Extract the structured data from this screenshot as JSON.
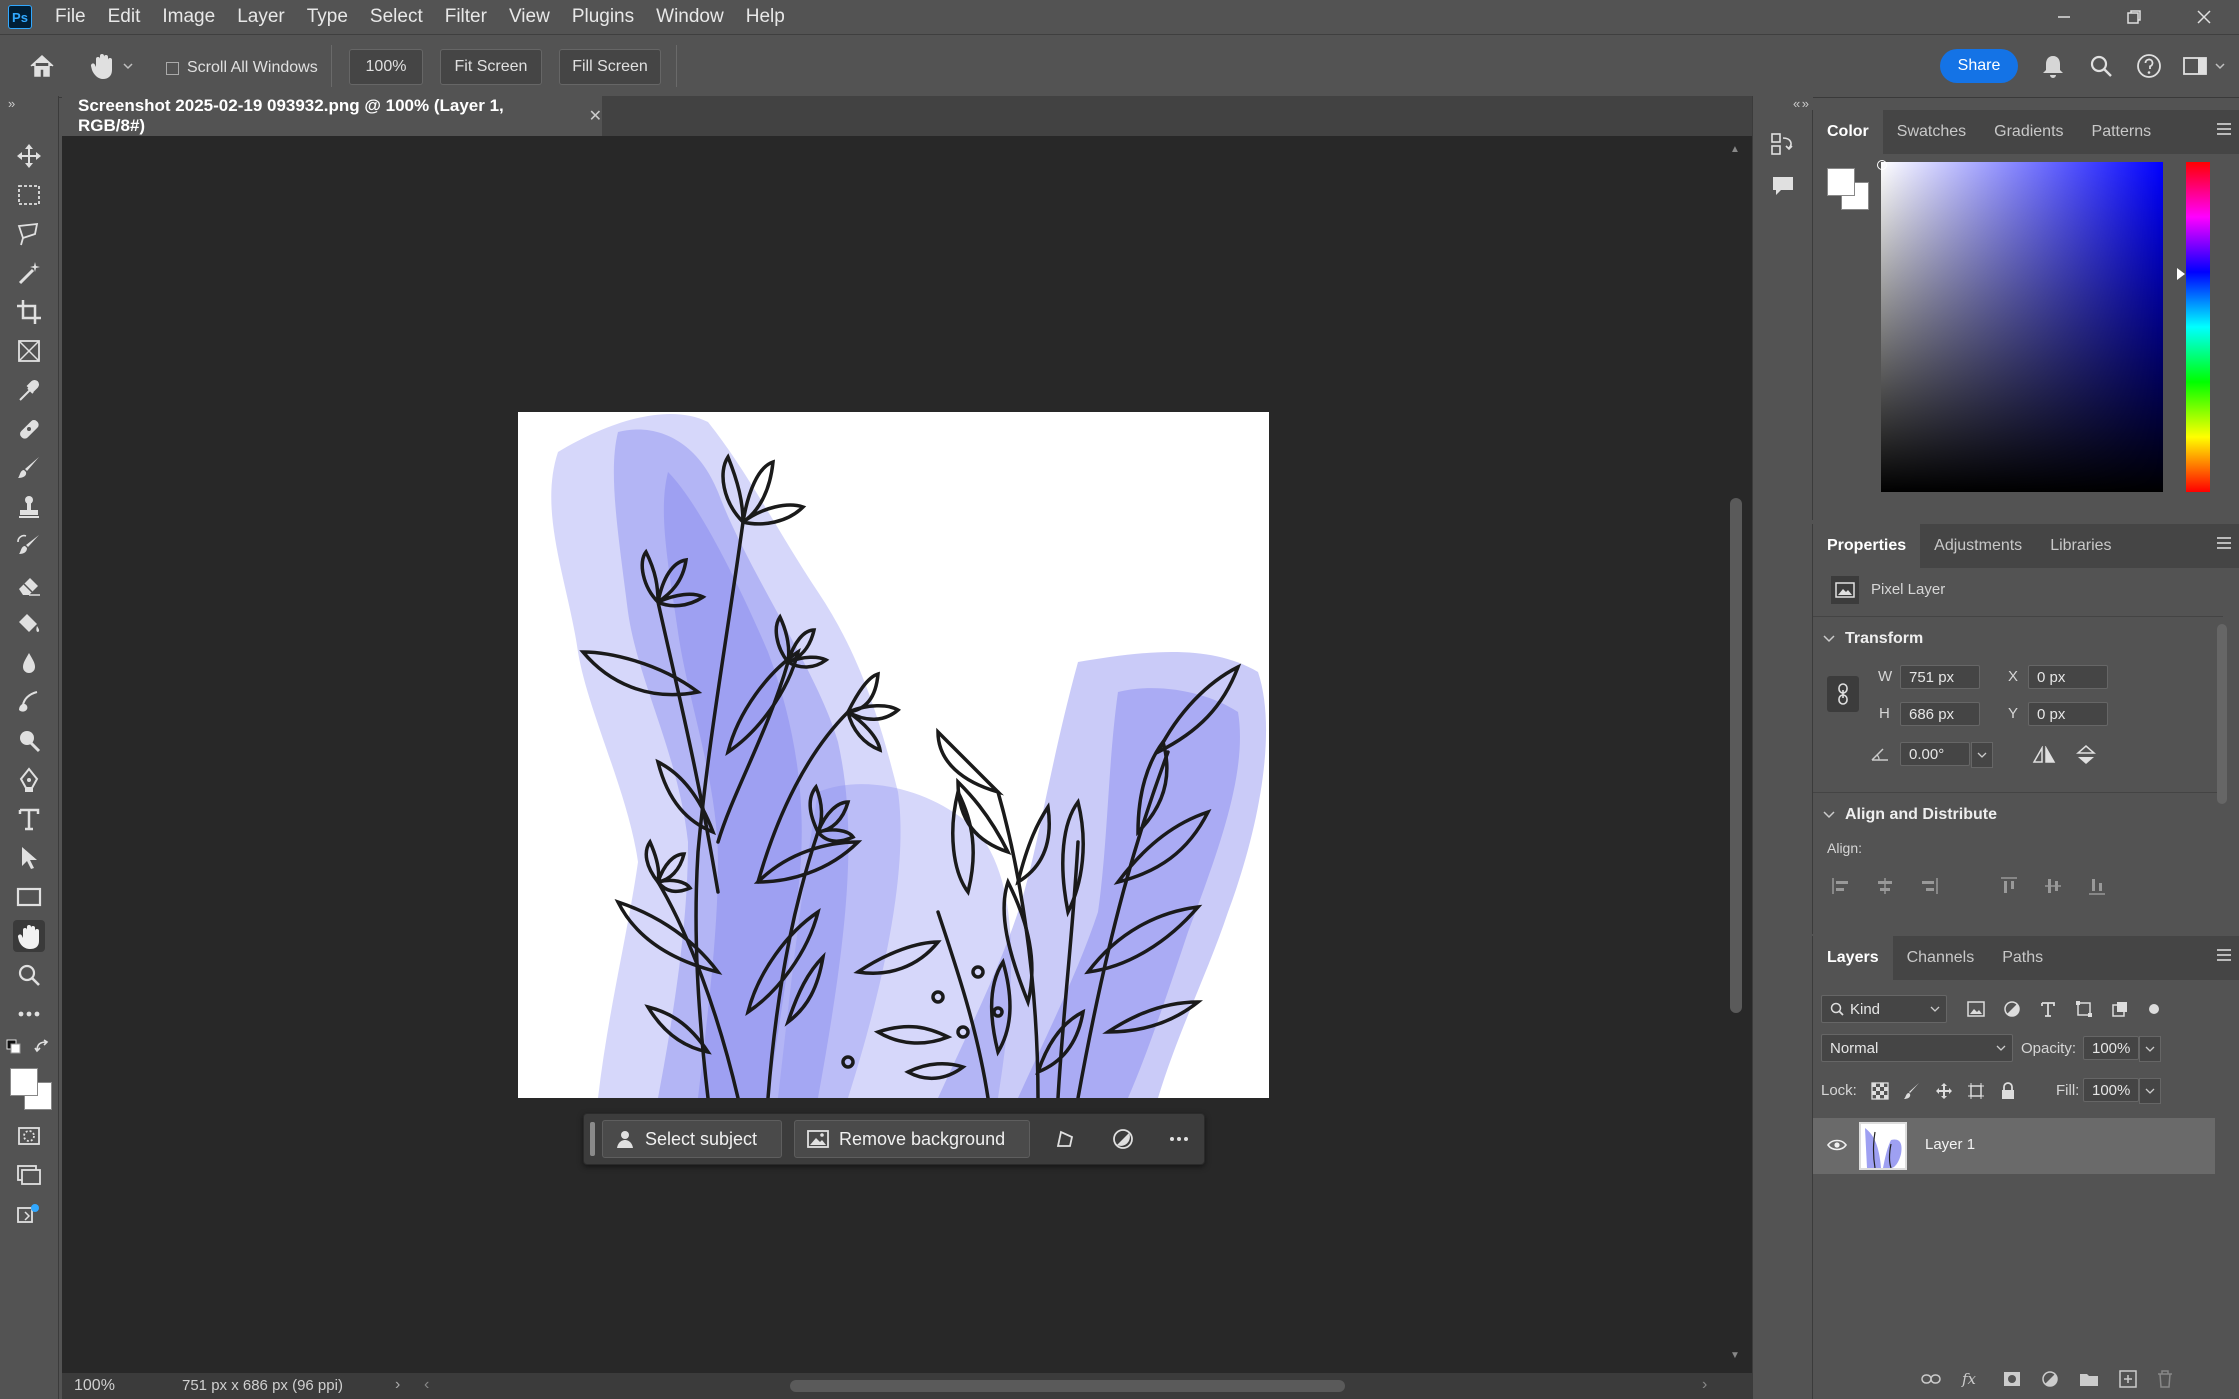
{
  "app": {
    "logo_text": "Ps"
  },
  "menu": [
    "File",
    "Edit",
    "Image",
    "Layer",
    "Type",
    "Select",
    "Filter",
    "View",
    "Plugins",
    "Window",
    "Help"
  ],
  "options_bar": {
    "scroll_all_windows": "Scroll All Windows",
    "zoom_value": "100%",
    "fit_screen": "Fit Screen",
    "fill_screen": "Fill Screen",
    "share": "Share"
  },
  "document": {
    "tab_title": "Screenshot 2025-02-19 093932.png @ 100% (Layer 1, RGB/8#)",
    "status_zoom": "100%",
    "status_info": "751 px x 686 px (96 ppi)"
  },
  "task_bar": {
    "select_subject": "Select subject",
    "remove_background": "Remove background"
  },
  "color_panel": {
    "tabs": [
      "Color",
      "Swatches",
      "Gradients",
      "Patterns"
    ],
    "active_hue": "#0000ff"
  },
  "properties_panel": {
    "tabs": [
      "Properties",
      "Adjustments",
      "Libraries"
    ],
    "layer_type": "Pixel Layer",
    "transform_title": "Transform",
    "w_label": "W",
    "w_value": "751 px",
    "h_label": "H",
    "h_value": "686 px",
    "x_label": "X",
    "x_value": "0 px",
    "y_label": "Y",
    "y_value": "0 px",
    "angle_value": "0.00°",
    "align_title": "Align and Distribute",
    "align_label": "Align:"
  },
  "layers_panel": {
    "tabs": [
      "Layers",
      "Channels",
      "Paths"
    ],
    "filter_kind": "Kind",
    "blend_mode": "Normal",
    "opacity_label": "Opacity:",
    "opacity_value": "100%",
    "lock_label": "Lock:",
    "fill_label": "Fill:",
    "fill_value": "100%",
    "layers": [
      {
        "name": "Layer 1"
      }
    ]
  },
  "colors": {
    "accent": "#1473e6",
    "wash": "#8a8cf0"
  }
}
